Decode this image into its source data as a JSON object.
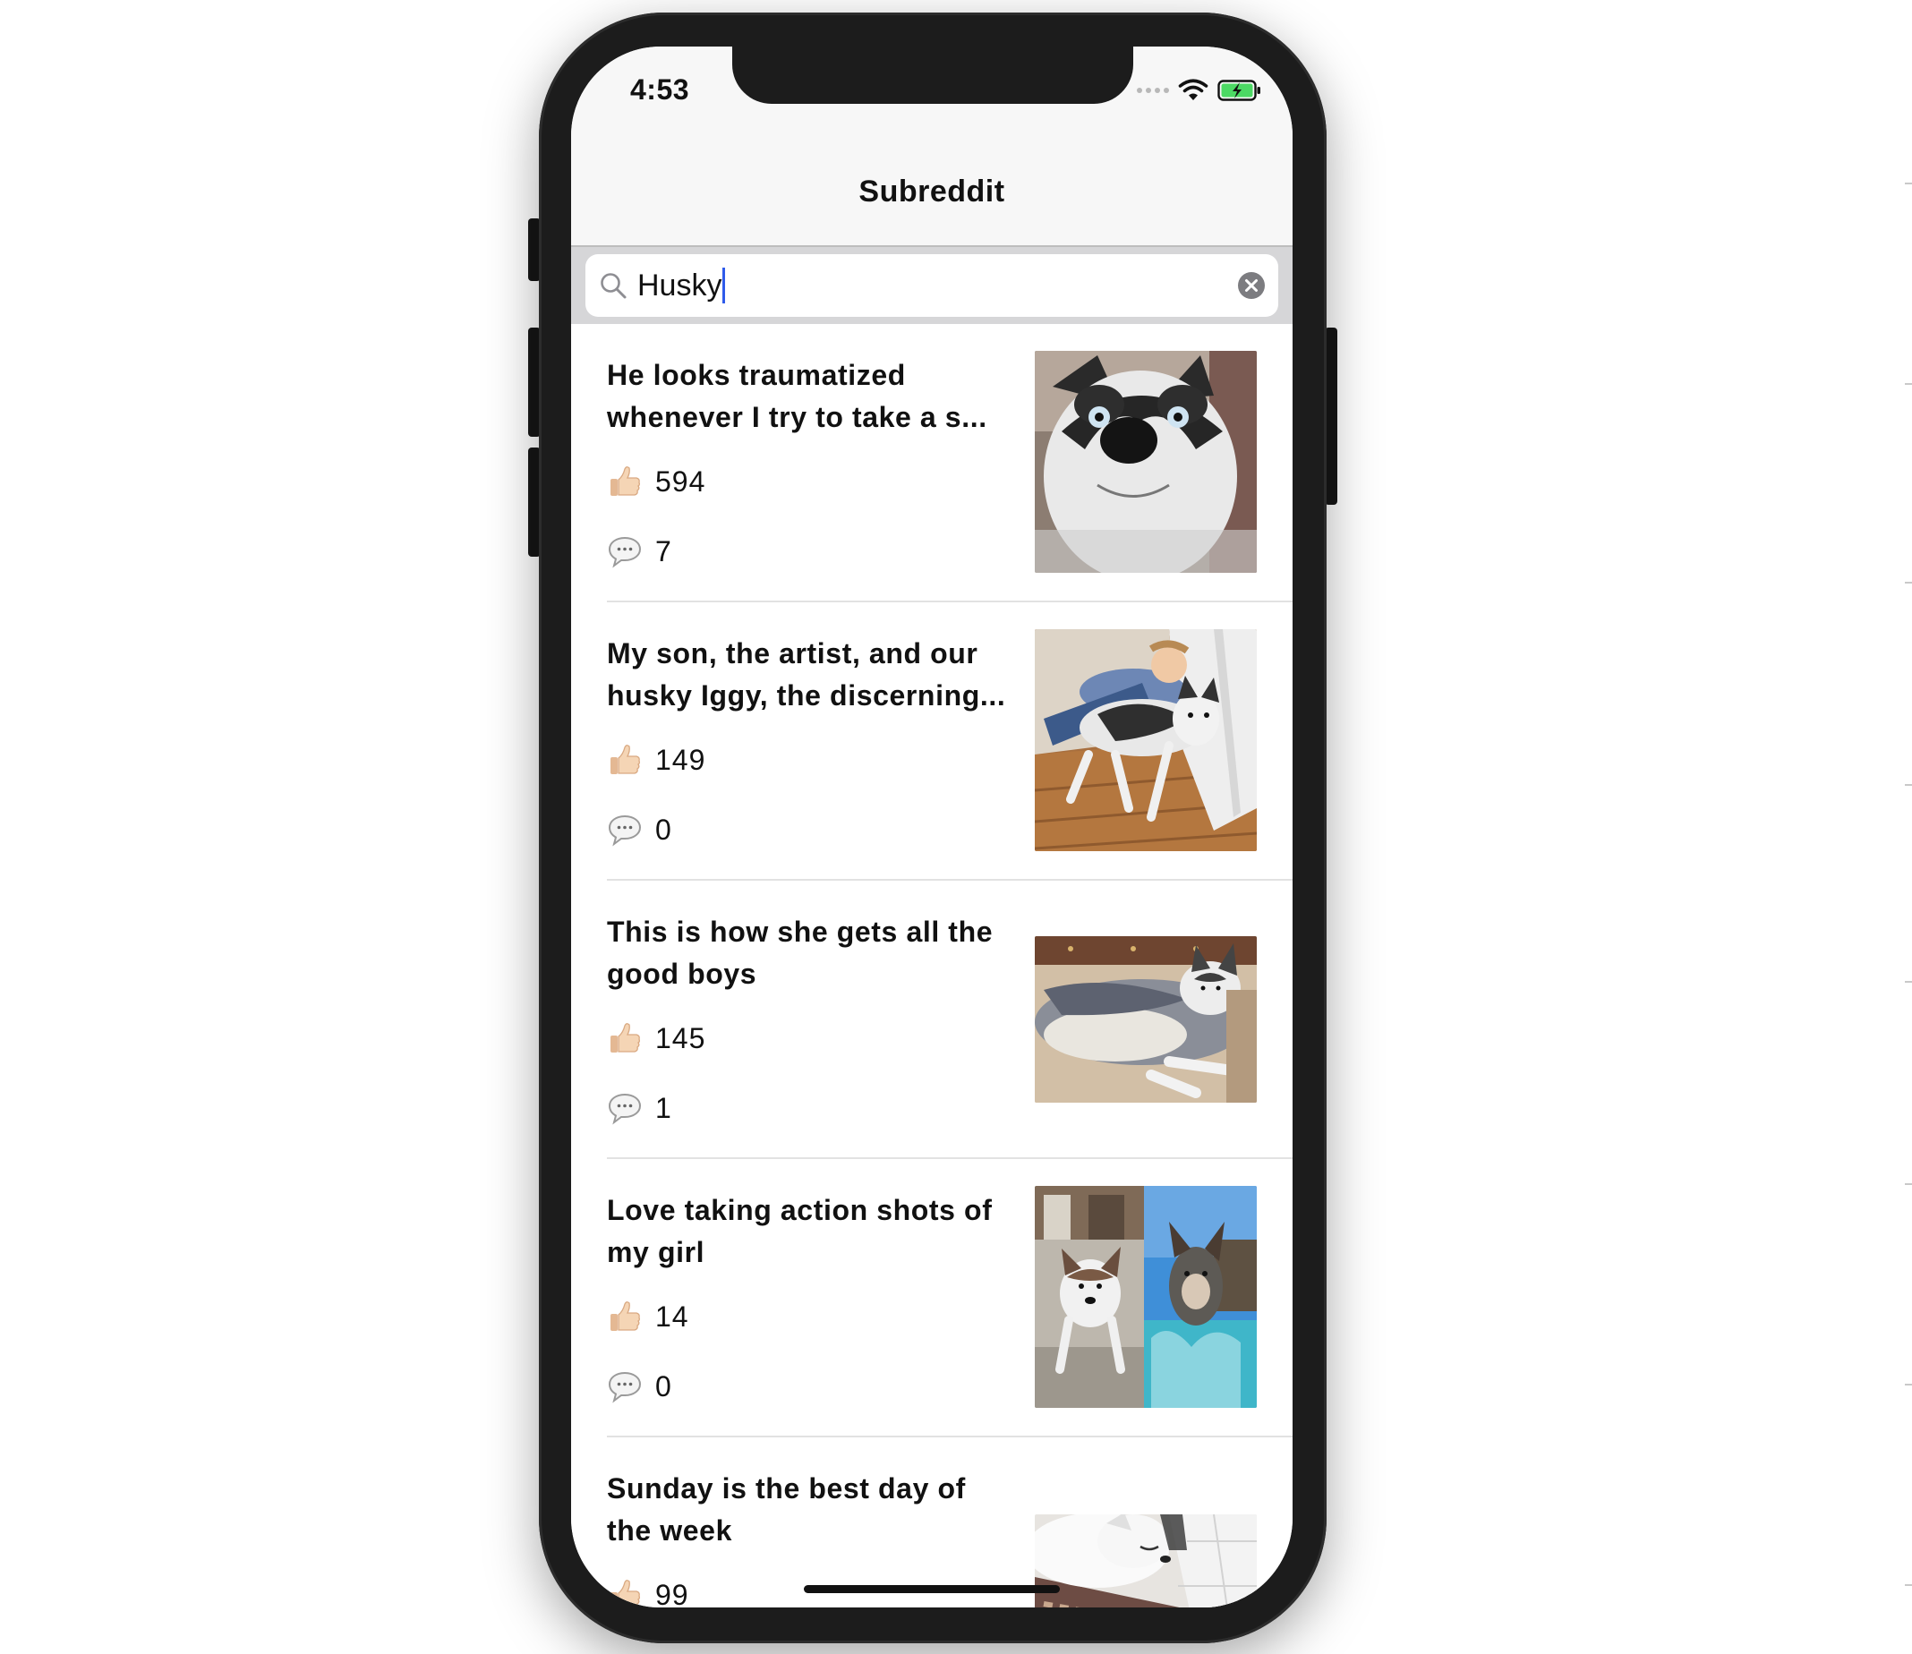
{
  "status_bar": {
    "time": "4:53",
    "icons": [
      "signal-icon",
      "wifi-icon",
      "battery-charging-icon"
    ]
  },
  "nav": {
    "title": "Subreddit"
  },
  "search": {
    "value": "Husky",
    "icons": [
      "search-icon",
      "clear-icon"
    ]
  },
  "posts": [
    {
      "title": "He looks traumatized whenever I try to take a s...",
      "likes": "594",
      "comments": "7",
      "image": "husky close-up face"
    },
    {
      "title": "My son, the artist, and our husky Iggy, the discerning...",
      "likes": "149",
      "comments": "0",
      "image": "boy with husky on wood floor"
    },
    {
      "title": "This is how she gets all the good boys",
      "likes": "145",
      "comments": "1",
      "image": "husky lying on carpet"
    },
    {
      "title": "Love taking action shots of my girl",
      "likes": "14",
      "comments": "0",
      "image": "husky puppy running and jumping in pool"
    },
    {
      "title": "Sunday is the best day of the week",
      "likes": "99",
      "comments": "",
      "image": "white husky sleeping on rug"
    }
  ],
  "colors": {
    "caret": "#2f5bea",
    "battery": "#4cd964",
    "navbar_bg": "#f7f7f7",
    "search_bg": "#d6d6d8"
  }
}
